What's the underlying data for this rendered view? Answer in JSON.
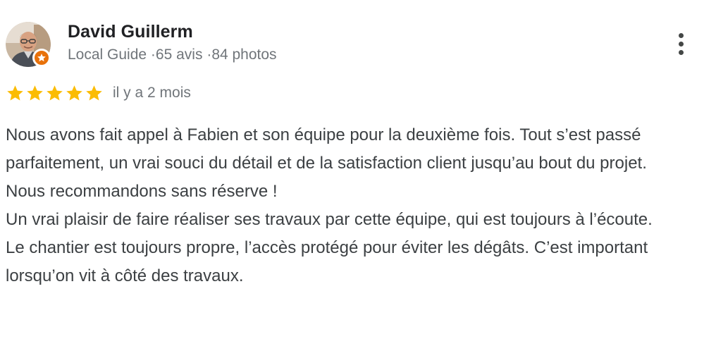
{
  "reviewer": {
    "name": "David Guillerm",
    "level": "Local Guide",
    "separator1": "·",
    "reviews_count": "65 avis",
    "separator2": "·",
    "photos_count": "84 photos",
    "avatar_icon": "person-photo-icon",
    "badge_icon": "local-guide-star-icon"
  },
  "rating": {
    "stars": 5,
    "max_stars": 5,
    "color": "#fbbc04"
  },
  "date": "il y a 2 mois",
  "review_paragraphs": [
    "Nous avons fait appel à Fabien et son équipe pour la deuxième fois. Tout s’est passé parfaitement, un vrai souci du détail et de la satisfaction client jusqu’au bout du projet.",
    "Nous recommandons sans réserve !",
    "Un vrai plaisir de faire réaliser ses travaux par cette équipe, qui est toujours à l’écoute.",
    "Le chantier est toujours propre, l’accès protégé pour éviter les dégâts. C’est important lorsqu’on vit à côté des travaux."
  ],
  "menu": {
    "icon": "more-vert-icon"
  },
  "colors": {
    "name": "#202124",
    "meta": "#70757a",
    "body": "#3c4043",
    "badge": "#e8710a",
    "star": "#fbbc04"
  }
}
